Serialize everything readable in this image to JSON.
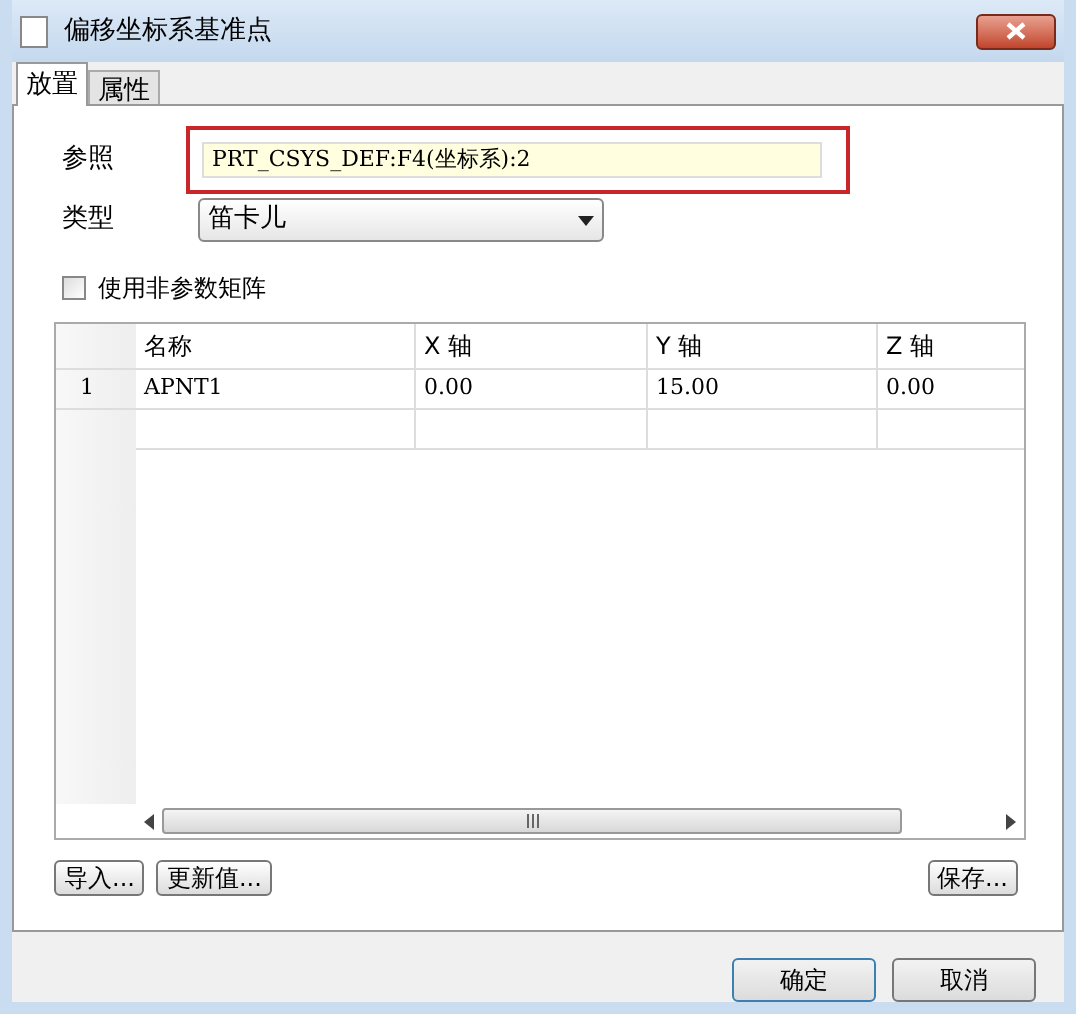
{
  "window": {
    "title": "偏移坐标系基准点"
  },
  "tabs": [
    {
      "label": "放置",
      "selected": true
    },
    {
      "label": "属性",
      "selected": false
    }
  ],
  "reference": {
    "label": "参照",
    "value": "PRT_CSYS_DEF:F4(坐标系):2"
  },
  "type": {
    "label": "类型",
    "value": "笛卡儿"
  },
  "non_parametric": {
    "label": "使用非参数矩阵",
    "checked": false
  },
  "table": {
    "columns": [
      "名称",
      "X 轴",
      "Y 轴",
      "Z 轴"
    ],
    "rows": [
      {
        "index": "1",
        "cells": [
          "APNT1",
          "0.00",
          "15.00",
          "0.00"
        ]
      }
    ]
  },
  "table_buttons": [
    "导入...",
    "更新值..."
  ],
  "save_button": "保存...",
  "dialog_buttons": [
    "确定",
    "取消"
  ]
}
